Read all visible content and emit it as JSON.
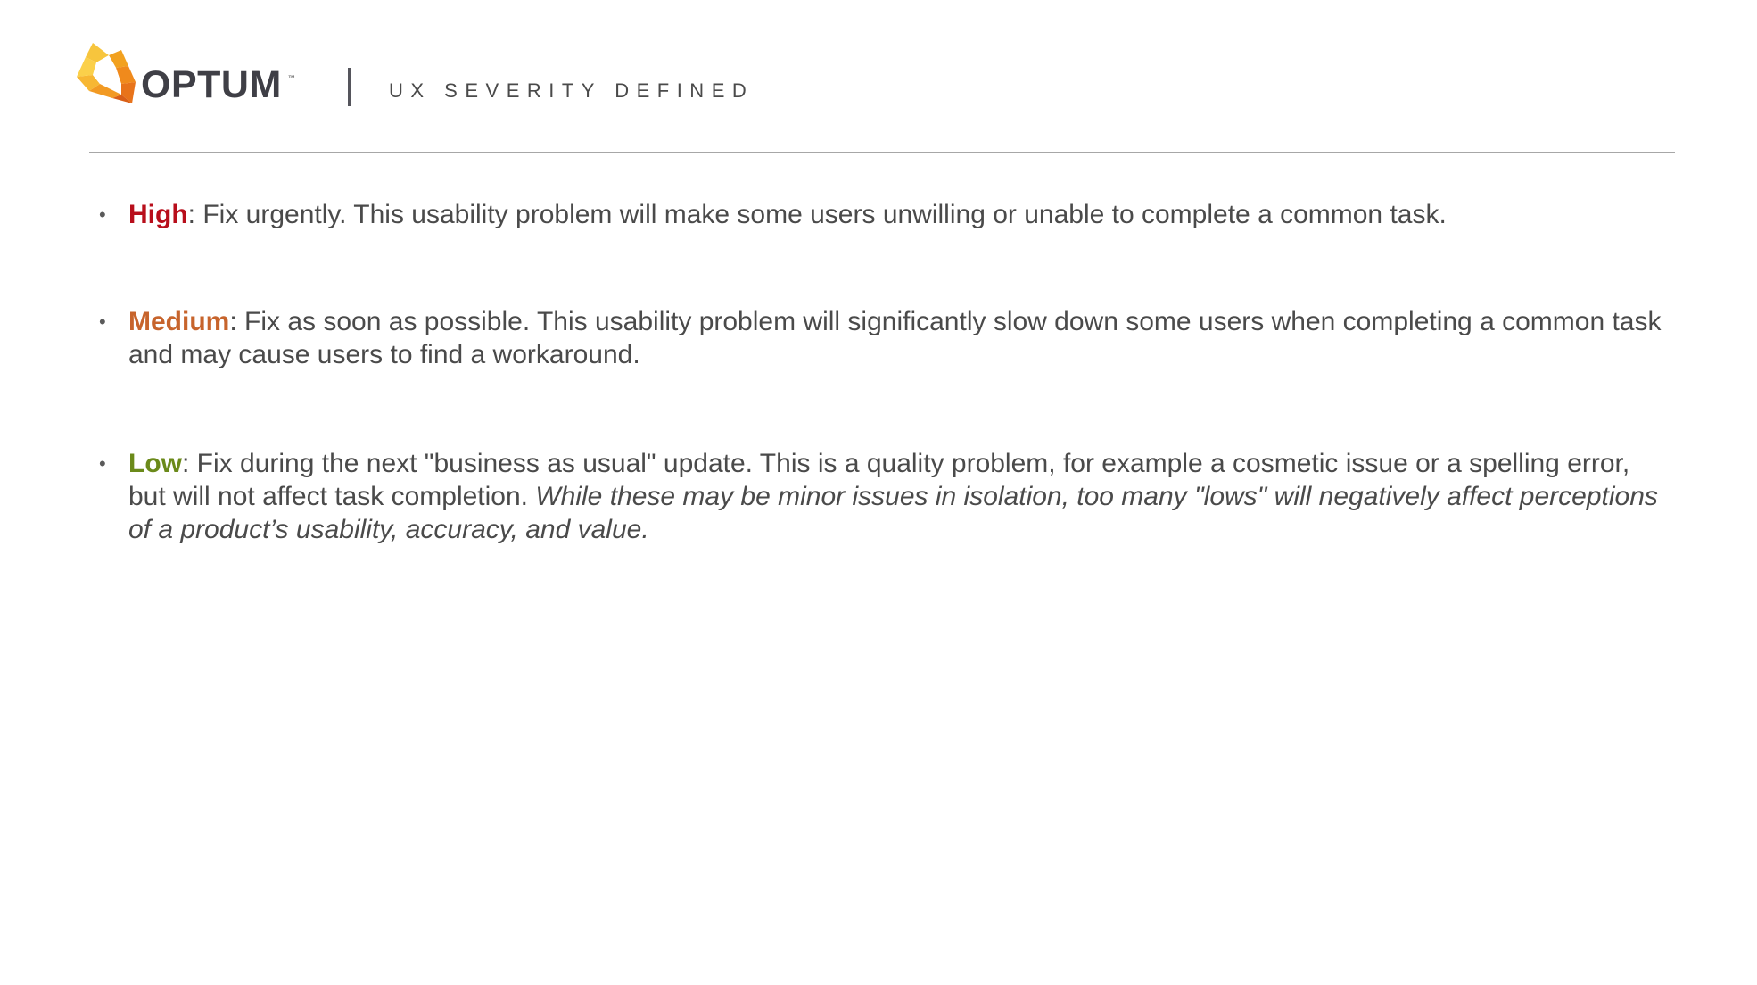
{
  "header": {
    "logo": {
      "wordmark": "OPTUM",
      "trademark": "™"
    },
    "title": "UX SEVERITY DEFINED"
  },
  "colors": {
    "high": "#b80e1b",
    "medium": "#c7642c",
    "low": "#6b8a1a",
    "body_text": "#4a4a4a",
    "logo_orange": "#f5a623"
  },
  "items": [
    {
      "level": "High",
      "separator": ":",
      "text": " Fix urgently. This usability problem will make some users unwilling or unable to complete a common task.",
      "note": ""
    },
    {
      "level": "Medium",
      "separator": ":",
      "text": " Fix as soon as possible. This usability problem will significantly slow down some users when completing a common task and may cause users to find a workaround.",
      "note": ""
    },
    {
      "level": "Low",
      "separator": ":",
      "text": " Fix during the next \"business as usual\" update. This is a quality problem, for example a cosmetic issue or a spelling error, but will not affect task completion. ",
      "note": "While these may be minor issues in isolation, too many \"lows\" will negatively affect perceptions of a product’s usability, accuracy, and value."
    }
  ]
}
